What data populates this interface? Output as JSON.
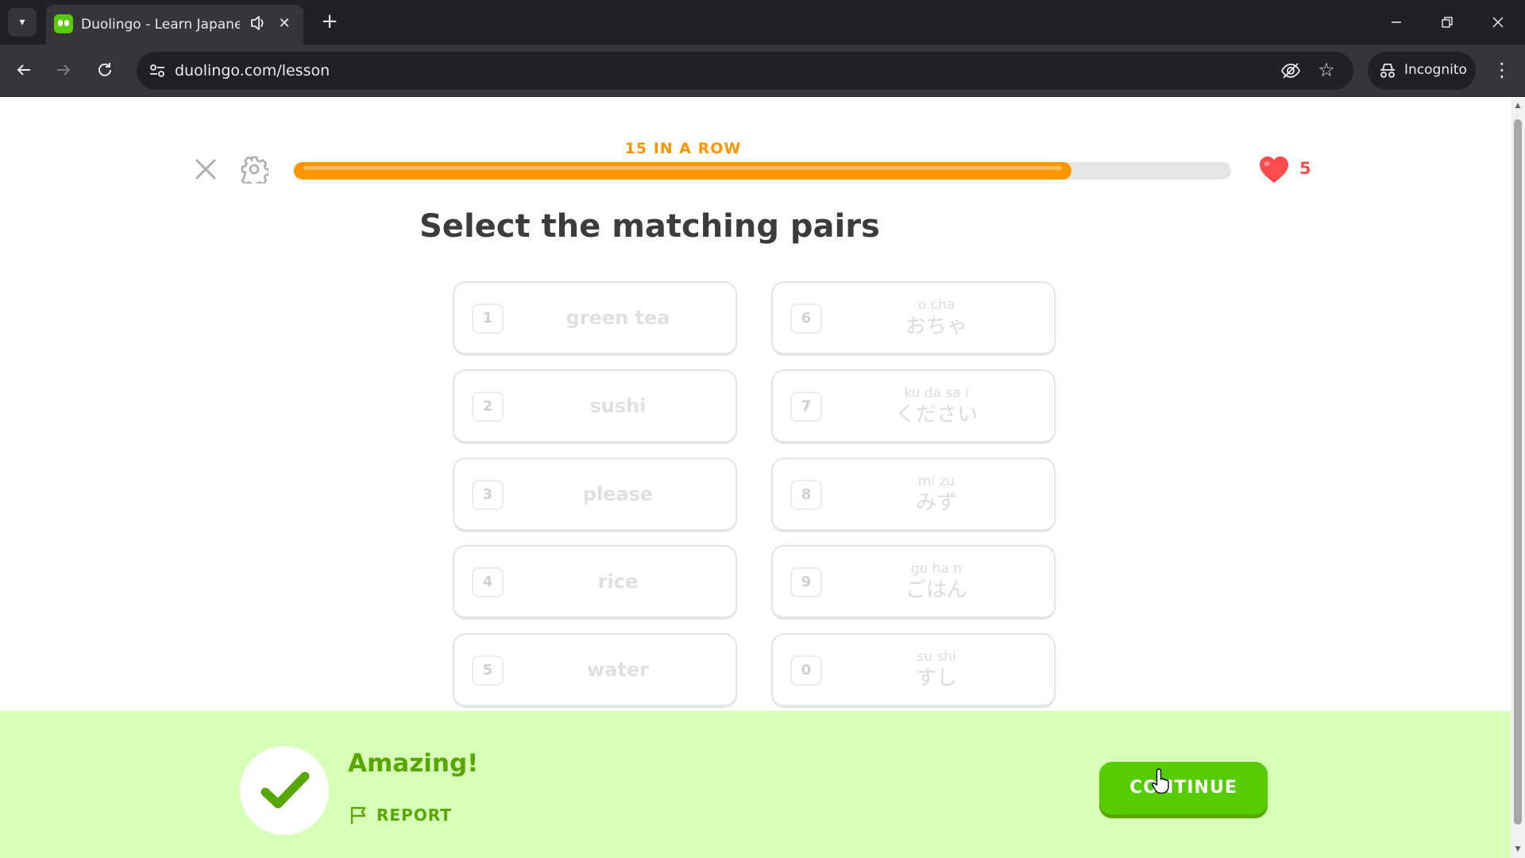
{
  "browser": {
    "tab_title": "Duolingo - Learn Japanese",
    "tab_close": "✕",
    "new_tab": "+",
    "url": "duolingo.com/lesson",
    "profile_label": "Incognito"
  },
  "lesson": {
    "streak_label": "15 IN A ROW",
    "progress_percent": 83,
    "hearts": "5",
    "title": "Select the matching pairs"
  },
  "pairs": {
    "left": [
      {
        "num": "1",
        "text": "green tea"
      },
      {
        "num": "2",
        "text": "sushi"
      },
      {
        "num": "3",
        "text": "please"
      },
      {
        "num": "4",
        "text": "rice"
      },
      {
        "num": "5",
        "text": "water"
      }
    ],
    "right": [
      {
        "num": "6",
        "ruby": "o  cha",
        "kana": "おちゃ"
      },
      {
        "num": "7",
        "ruby": "ku da sa  i",
        "kana": "ください"
      },
      {
        "num": "8",
        "ruby": "mi zu",
        "kana": "みず"
      },
      {
        "num": "9",
        "ruby": "go ha  n",
        "kana": "ごはん"
      },
      {
        "num": "0",
        "ruby": "su shi",
        "kana": "すし"
      }
    ]
  },
  "feedback": {
    "title": "Amazing!",
    "report_label": "REPORT",
    "continue_label": "CONTINUE"
  },
  "colors": {
    "brand_green": "#58cc02",
    "progress_orange": "#ff9600",
    "heart_red": "#ff4b4b",
    "feedback_bg": "#d7ffb8"
  }
}
